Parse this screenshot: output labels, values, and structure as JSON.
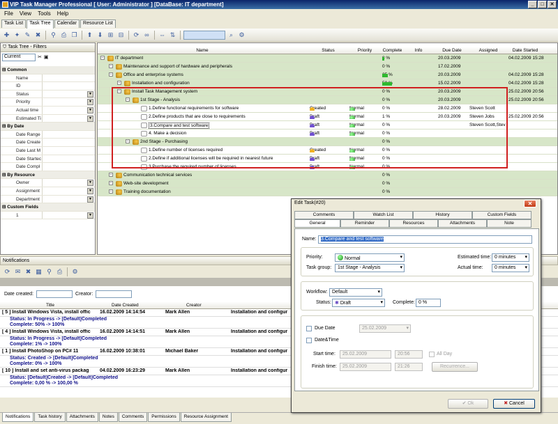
{
  "title": "VIP Task Manager Professional [ User: Administrator ] [DataBase: IT department]",
  "menu": [
    "File",
    "View",
    "Tools",
    "Help"
  ],
  "top_tabs": [
    "Task List",
    "Task Tree",
    "Calendar",
    "Resource List"
  ],
  "left": {
    "header": "Task Tree - Filters",
    "view": "Current",
    "groups": [
      {
        "label": "Common",
        "rows": [
          "Name",
          "ID",
          "Status",
          "Priority",
          "Actual time",
          "Estimated Ti"
        ]
      },
      {
        "label": "By Date",
        "rows": [
          "Date Range",
          "Date Create",
          "Date Last M",
          "Date Startec",
          "Date Compl"
        ]
      },
      {
        "label": "By Resource",
        "rows": [
          "Owner",
          "Assignment",
          "Department"
        ]
      },
      {
        "label": "Custom Fields",
        "rows": [
          "1"
        ]
      }
    ]
  },
  "tree": {
    "columns": [
      "Name",
      "Status",
      "Priority",
      "Complete",
      "Info",
      "Due Date",
      "Assigned",
      "Date Started"
    ],
    "rows": [
      {
        "name": "IT department",
        "status": "",
        "priority": "",
        "complete": "8 %",
        "due": "20.03.2009",
        "assigned": "",
        "started": "04.02.2009 15:28",
        "level": 0,
        "green": true,
        "bar": 3
      },
      {
        "name": "Maintenance and support of hardware and peripherals",
        "status": "",
        "priority": "",
        "complete": "0 %",
        "due": "17.02.2009",
        "assigned": "",
        "started": "",
        "level": 1,
        "green": true,
        "bar": 0
      },
      {
        "name": "Office and enterprise systems",
        "status": "",
        "priority": "",
        "complete": "25 %",
        "due": "20.03.2009",
        "assigned": "",
        "started": "04.02.2009 15:28",
        "level": 1,
        "green": true,
        "bar": 8
      },
      {
        "name": "Installation and configuration",
        "status": "",
        "priority": "",
        "complete": "50 %",
        "due": "15.02.2009",
        "assigned": "",
        "started": "04.02.2009 15:28",
        "level": 2,
        "green": true,
        "bar": 14
      },
      {
        "name": "Install Task Management system",
        "status": "",
        "priority": "",
        "complete": "0 %",
        "due": "20.03.2009",
        "assigned": "",
        "started": "25.02.2009 20:56",
        "level": 2,
        "green": true,
        "bar": 0
      },
      {
        "name": "1st Stage - Analysis",
        "status": "",
        "priority": "",
        "complete": "0 %",
        "due": "20.03.2009",
        "assigned": "",
        "started": "25.02.2009 20:56",
        "level": 3,
        "green": true,
        "bar": 0
      },
      {
        "name": "1.Define functional requirements for software",
        "status": "Created",
        "priority": "Normal",
        "complete": "0 %",
        "due": "28.02.2009",
        "assigned": "Steven Scott",
        "started": "",
        "level": 4,
        "green": false,
        "bar": 0
      },
      {
        "name": "2.Define products that are close to requirements",
        "status": "Draft",
        "priority": "Normal",
        "complete": "1 %",
        "due": "20.03.2009",
        "assigned": "Steven Jobs",
        "started": "25.02.2009 20:56",
        "level": 4,
        "green": false,
        "bar": 0
      },
      {
        "name": "3.Compare and test software",
        "status": "Draft",
        "priority": "Normal",
        "complete": "0 %",
        "due": "",
        "assigned": "Steven Scott,Stev",
        "started": "",
        "level": 4,
        "green": false,
        "bar": 0
      },
      {
        "name": "4. Make a decision",
        "status": "Draft",
        "priority": "Normal",
        "complete": "0 %",
        "due": "",
        "assigned": "",
        "started": "",
        "level": 4,
        "green": false,
        "bar": 0
      },
      {
        "name": "2nd Stage - Purchasing",
        "status": "",
        "priority": "",
        "complete": "0 %",
        "due": "",
        "assigned": "",
        "started": "",
        "level": 3,
        "green": true,
        "bar": 0
      },
      {
        "name": "1.Define number of licenses required",
        "status": "Created",
        "priority": "Normal",
        "complete": "0 %",
        "due": "",
        "assigned": "",
        "started": "",
        "level": 4,
        "green": false,
        "bar": 0
      },
      {
        "name": "2.Define if additional licenses will be required in nearest future",
        "status": "Draft",
        "priority": "Normal",
        "complete": "0 %",
        "due": "",
        "assigned": "",
        "started": "",
        "level": 4,
        "green": false,
        "bar": 0
      },
      {
        "name": "3.Purchase the required number of licenses",
        "status": "Draft",
        "priority": "Normal",
        "complete": "0 %",
        "due": "",
        "assigned": "",
        "started": "",
        "level": 4,
        "green": false,
        "bar": 0
      },
      {
        "name": "Communication technical services",
        "status": "",
        "priority": "",
        "complete": "0 %",
        "due": "",
        "assigned": "",
        "started": "",
        "level": 1,
        "green": true,
        "bar": 0
      },
      {
        "name": "Web-site development",
        "status": "",
        "priority": "",
        "complete": "0 %",
        "due": "",
        "assigned": "",
        "started": "",
        "level": 1,
        "green": true,
        "bar": 0
      },
      {
        "name": "Training documentation",
        "status": "",
        "priority": "",
        "complete": "0 %",
        "due": "",
        "assigned": "",
        "started": "",
        "level": 1,
        "green": true,
        "bar": 0
      }
    ]
  },
  "notifications": {
    "header": "Notifications",
    "date_created_label": "Date created:",
    "creator_label": "Creator:",
    "columns": [
      "Title",
      "Date Created",
      "Creator"
    ],
    "items": [
      {
        "title": "[ 5 ] Install Windows Vista, install offic",
        "date": "16.02.2009 14:14:54",
        "creator": "Mark Allen",
        "extra": "Installation and configur",
        "detail1": "Status: In Progress -> [Default]Completed",
        "detail2": "Complete: 50% -> 100%"
      },
      {
        "title": "[ 4 ] Install Windows Vista, install offic",
        "date": "16.02.2009 14:14:51",
        "creator": "Mark Allen",
        "extra": "Installation and configur",
        "detail1": "Status: In Progress -> [Default]Completed",
        "detail2": "Complete: 1% -> 100%"
      },
      {
        "title": "[ 1 ] Install PhotoShop on PC# 11",
        "date": "16.02.2009 10:38:01",
        "creator": "Michael Baker",
        "extra": "Installation and configur",
        "detail1": "Status: Created -> [Default]Completed",
        "detail2": "Complete: 0% -> 100%"
      },
      {
        "title": "[ 10 ] Install and set anti-virus packag",
        "date": "04.02.2009 16:23:29",
        "creator": "Mark Allen",
        "extra": "Installation and configur",
        "detail1": "Status: [Default]Created -> [Default]Completed",
        "detail2": "Complete: 0,00 % -> 100,00 %"
      }
    ]
  },
  "bottom_tabs": [
    "Notifications",
    "Task history",
    "Attachments",
    "Notes",
    "Comments",
    "Permissions",
    "Resource Assignment"
  ],
  "dialog": {
    "title": "Edit Task(#20)",
    "tabs_row1": [
      "Comments",
      "Watch List",
      "History",
      "Custom Fields"
    ],
    "tabs_row2": [
      "General",
      "Reminder",
      "Resources",
      "Attachments",
      "Note"
    ],
    "name_label": "Name:",
    "name_value": "3.Compare and test software",
    "priority_label": "Priority:",
    "priority_value": "Normal",
    "task_group_label": "Task group:",
    "task_group_value": "1st Stage - Analysis",
    "est_label": "Estimated time:",
    "est_value": "0 minutes",
    "act_label": "Actual time:",
    "act_value": "0 minutes",
    "workflow_label": "Workflow:",
    "workflow_value": "Default",
    "status_label": "Status:",
    "status_value": "Draft",
    "complete_label": "Complete:",
    "complete_value": "0 %",
    "due_label": "Due Date",
    "due_value": "25.02.2009",
    "datetime_label": "Date&Time",
    "start_label": "Start time:",
    "start_date": "25.02.2009",
    "start_time": "20:56",
    "allday_label": "All Day",
    "finish_label": "Finish time:",
    "finish_date": "25.02.2009",
    "finish_time": "21:26",
    "recurrence": "Recurrence...",
    "ok": "Ok",
    "cancel": "Cancel"
  }
}
